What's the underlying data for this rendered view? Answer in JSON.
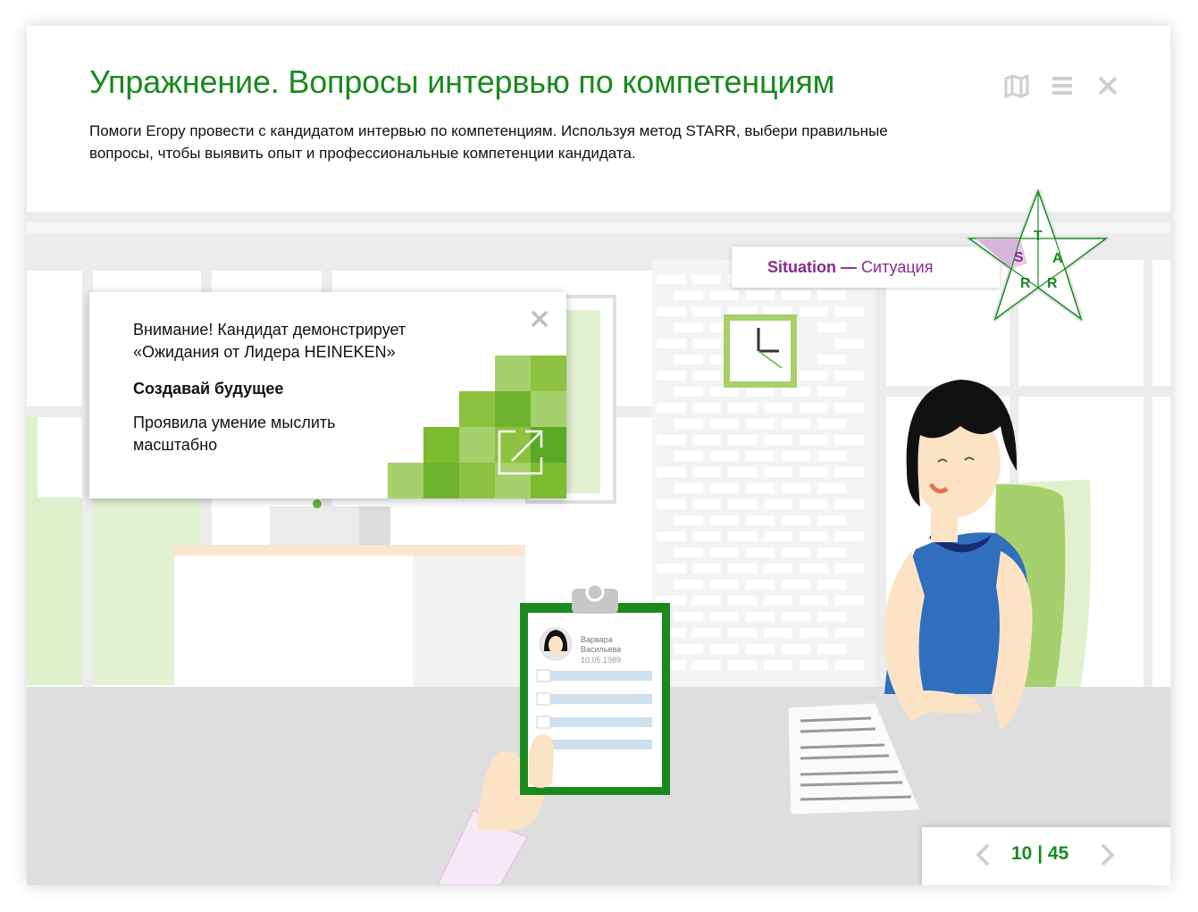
{
  "header": {
    "title": "Упражнение. Вопросы интервью по компетенциям",
    "description": "Помоги Егору провести с кандидатом интервью по компетенциям. Используя метод STARR, выбери правильные вопросы, чтобы выявить опыт и профессиональные компетенции кандидата."
  },
  "controls": {
    "map_icon": "map-icon",
    "menu_icon": "menu-icon",
    "close_icon": "close-icon"
  },
  "popup": {
    "attention": "Внимание! Кандидат демонстрирует «Ожидания от Лидера HEINEKEN»",
    "competency": "Создавай будущее",
    "detail": "Проявила умение мыслить масштабно",
    "close_icon": "close-icon",
    "expand_icon": "expand-icon"
  },
  "stage": {
    "english": "Situation",
    "dash": " — ",
    "russian": "Ситуация"
  },
  "starr": {
    "letters": [
      "S",
      "T",
      "A",
      "R",
      "R"
    ],
    "active": "S"
  },
  "clipboard": {
    "name_line1": "Варвара",
    "name_line2": "Васильева",
    "date": "10.05.1989"
  },
  "pagination": {
    "counter": "10 | 45",
    "prev_icon": "chevron-left-icon",
    "next_icon": "chevron-right-icon"
  },
  "colors": {
    "brand_green": "#1a8a1f",
    "light_green": "#a6d06b",
    "purple": "#8b2a8f"
  }
}
